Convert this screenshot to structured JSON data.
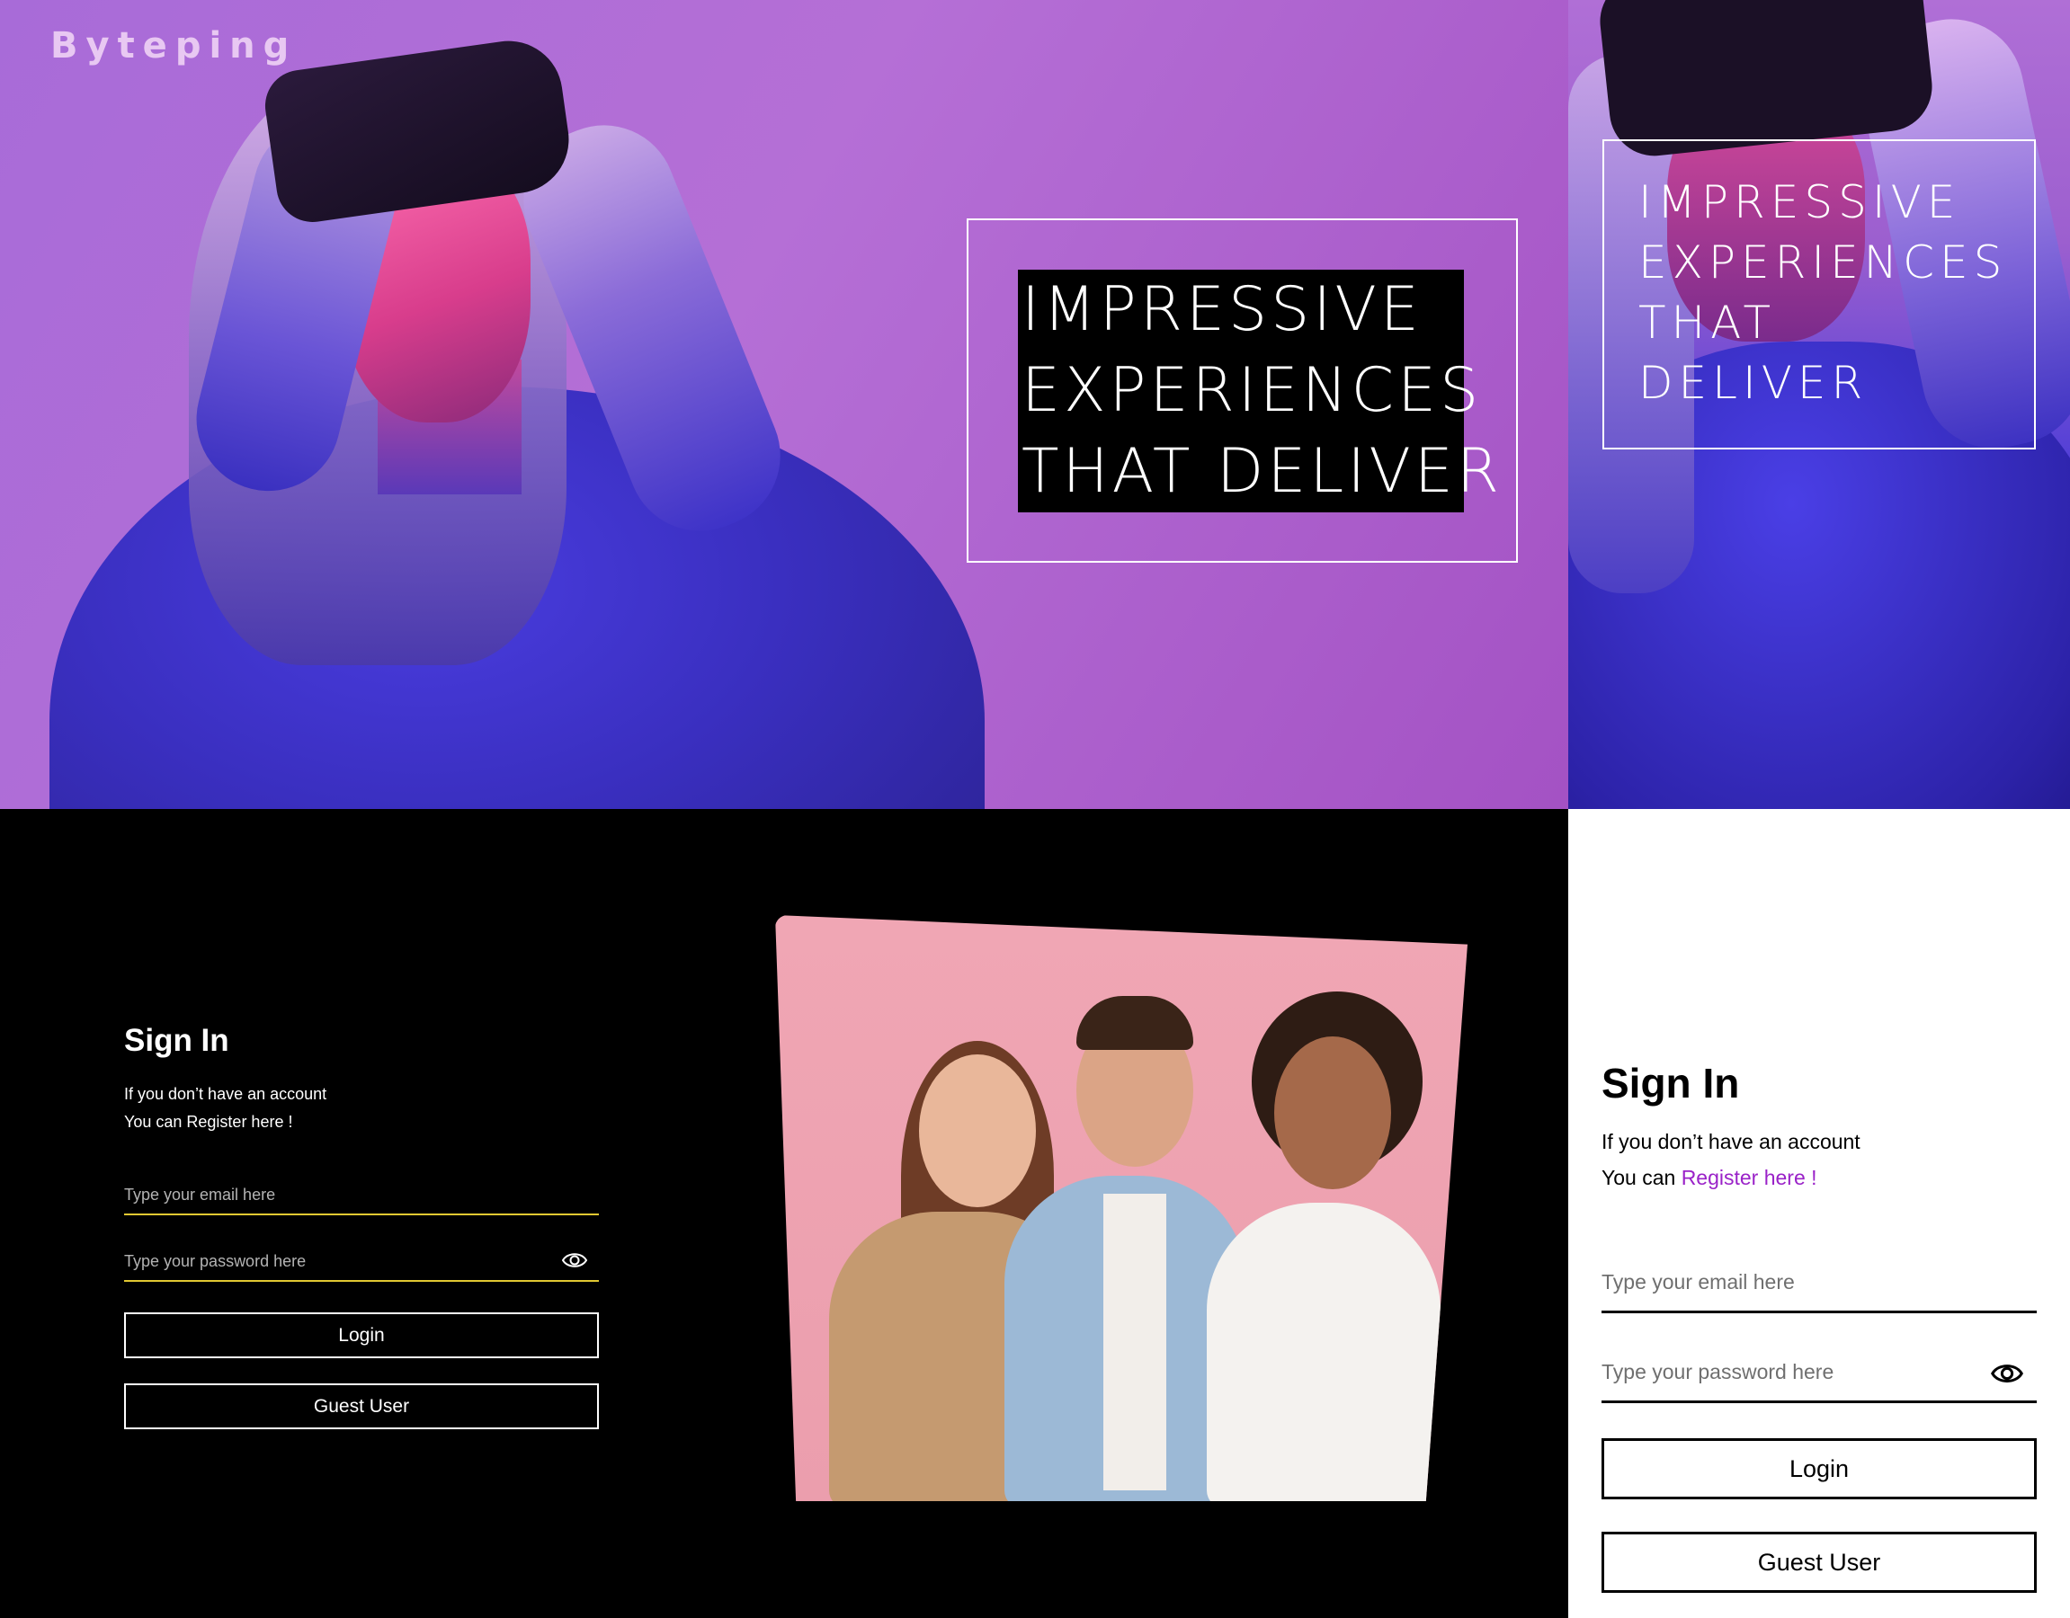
{
  "brand": {
    "name": "Byteping"
  },
  "hero": {
    "headline_lines": [
      "IMPRESSIVE",
      "EXPERIENCES",
      "THAT DELIVER"
    ],
    "mobile_headline_lines": [
      "IMPRESSIVE",
      "EXPERIENCES",
      "THAT",
      "DELIVER"
    ]
  },
  "signin": {
    "title": "Sign In",
    "line1": "If you don’t have an account",
    "line2_prefix": "You can ",
    "register_link": "Register here !",
    "email_placeholder": "Type your email here",
    "password_placeholder": "Type your password here",
    "login_label": "Login",
    "guest_label": "Guest User"
  },
  "colors": {
    "hero_purple": "#b56fd6",
    "field_underline_dark": "#e1c832",
    "register_link_light": "#9a22c8",
    "photo_background": "#f0a6b4"
  },
  "icons": {
    "password_toggle": "eye-icon"
  }
}
